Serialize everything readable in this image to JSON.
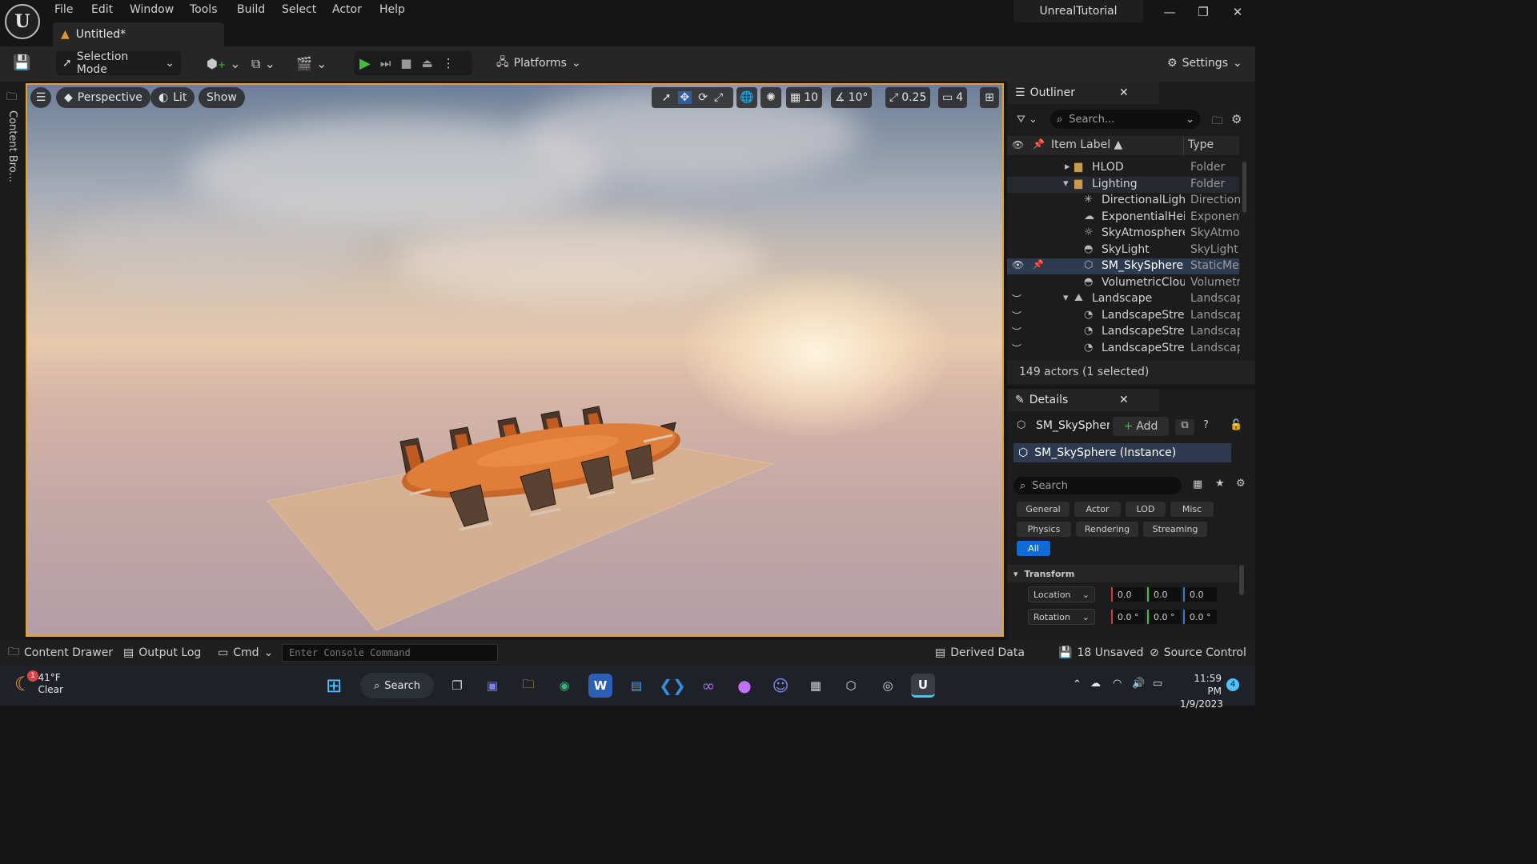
{
  "app": {
    "title": "UnrealTutorial",
    "logo_letter": "U",
    "document_tab": "Untitled*",
    "menu": [
      "File",
      "Edit",
      "Window",
      "Tools",
      "Build",
      "Select",
      "Actor",
      "Help"
    ]
  },
  "toolbar": {
    "selection_mode": "Selection Mode",
    "platforms": "Platforms",
    "settings": "Settings"
  },
  "left_strip": {
    "content_browser": "Content Bro..."
  },
  "viewport": {
    "perspective": "Perspective",
    "lit": "Lit",
    "show": "Show",
    "grid_snap": "10",
    "rotation_snap": "10°",
    "scale_snap": "0.25",
    "camera_speed": "4"
  },
  "outliner": {
    "title": "Outliner",
    "search_placeholder": "Search...",
    "col_label": "Item Label ▲",
    "col_type": "Type",
    "rows": [
      {
        "label": "HLOD",
        "type": "Folder"
      },
      {
        "label": "Lighting",
        "type": "Folder"
      },
      {
        "label": "DirectionalLight",
        "type": "Directiona"
      },
      {
        "label": "ExponentialHeig",
        "type": "Exponent"
      },
      {
        "label": "SkyAtmosphere",
        "type": "SkyAtmos"
      },
      {
        "label": "SkyLight",
        "type": "SkyLight"
      },
      {
        "label": "SM_SkySphere",
        "type": "StaticMes"
      },
      {
        "label": "VolumetricClouc",
        "type": "Volumetri"
      },
      {
        "label": "Landscape",
        "type": "Landscap"
      },
      {
        "label": "LandscapeStrea",
        "type": "Landscap"
      },
      {
        "label": "LandscapeStrea",
        "type": "Landscap"
      },
      {
        "label": "LandscapeStrea",
        "type": "Landscap"
      }
    ],
    "footer": "149 actors (1 selected)"
  },
  "details": {
    "title": "Details",
    "object_name": "SM_SkySpher",
    "add": "Add",
    "instance": "SM_SkySphere (Instance)",
    "search_placeholder": "Search",
    "filters": [
      "General",
      "Actor",
      "LOD",
      "Misc",
      "Physics",
      "Rendering",
      "Streaming",
      "All"
    ],
    "transform_header": "Transform",
    "location_label": "Location",
    "rotation_label": "Rotation",
    "location": [
      "0.0",
      "0.0",
      "0.0"
    ],
    "rotation": [
      "0.0 °",
      "0.0 °",
      "0.0 °"
    ]
  },
  "statusbar": {
    "content_drawer": "Content Drawer",
    "output_log": "Output Log",
    "cmd": "Cmd",
    "console_placeholder": "Enter Console Command",
    "derived_data": "Derived Data",
    "unsaved": "18 Unsaved",
    "source_control": "Source Control"
  },
  "taskbar": {
    "weather_temp": "41°F",
    "weather_desc": "Clear",
    "weather_badge": "1",
    "search": "Search",
    "time": "11:59 PM",
    "date": "1/9/2023",
    "notif_count": "4"
  },
  "colors": {
    "accent_selection": "#e6a516",
    "play_green": "#3fbf3f",
    "row_selected": "#2d3a4f",
    "filter_active": "#0a6dd8"
  }
}
